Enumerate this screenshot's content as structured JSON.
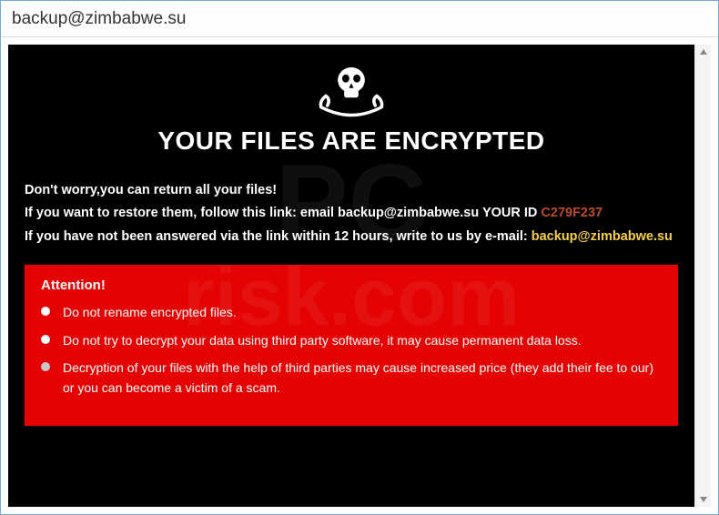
{
  "window": {
    "title": "backup@zimbabwe.su"
  },
  "heading": "YOUR FILES ARE ENCRYPTED",
  "lines": {
    "l1": "Don't worry,you can return all your files!",
    "l2_pre": "If you want to restore them, follow this link: ",
    "l2_email_label": "email ",
    "l2_email": "backup@zimbabwe.su",
    "l2_id_label": "   YOUR ID ",
    "l2_id": "C279F237",
    "l3_pre": "If you have not been answered via the link within 12 hours, write to us by e-mail: ",
    "l3_email": "backup@zimbabwe.su"
  },
  "alert": {
    "title": "Attention!",
    "items": [
      "Do not rename encrypted files.",
      "Do not try to decrypt your data using third party software, it may cause permanent data loss.",
      "Decryption of your files with the help of third parties may cause increased price (they add their fee to our) or you can become a victim of a scam."
    ]
  },
  "watermark": {
    "line1": "PC",
    "line2": "risk.com"
  }
}
